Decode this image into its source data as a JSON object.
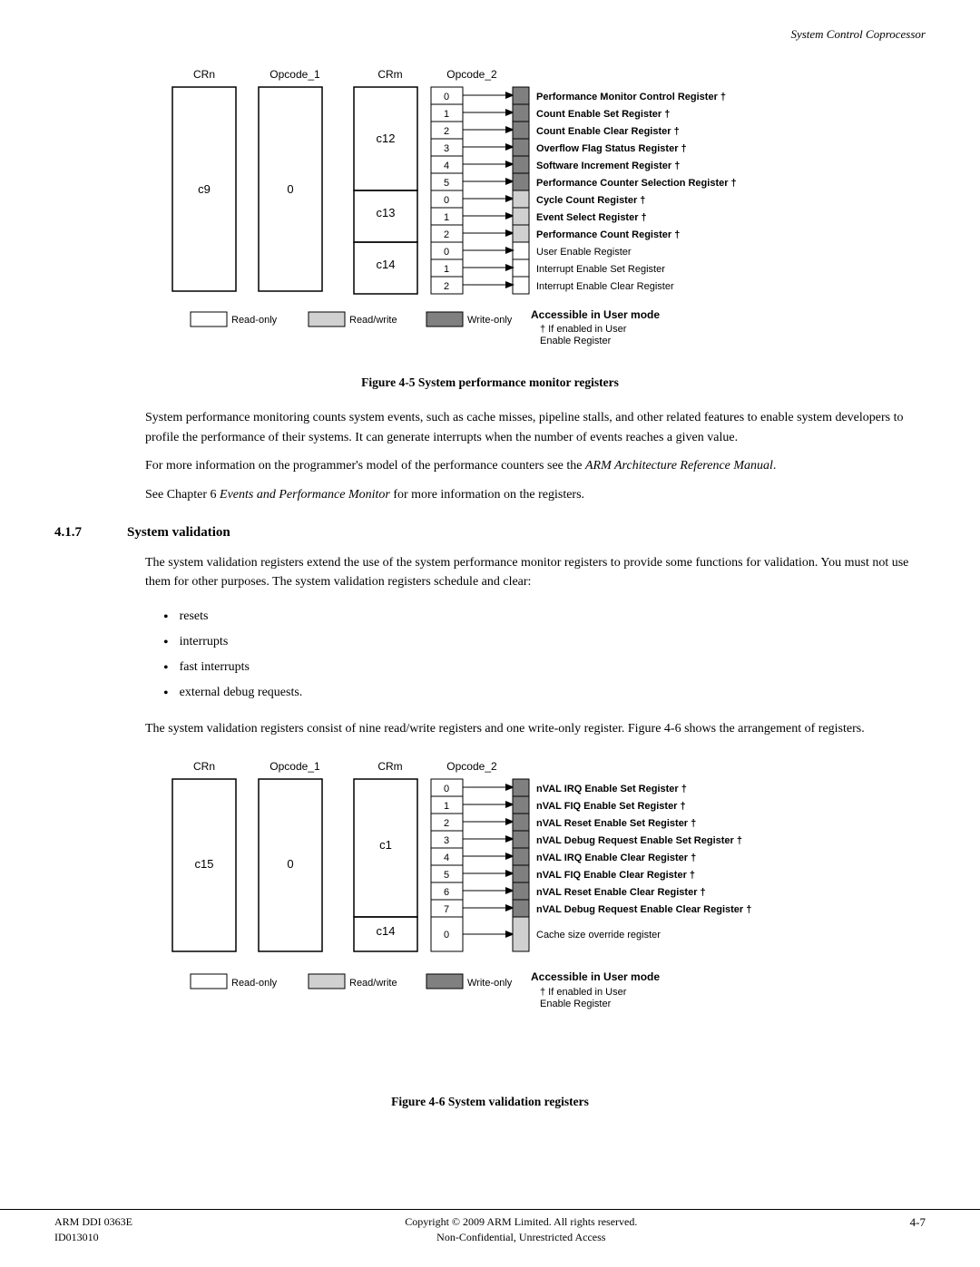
{
  "header": {
    "title": "System Control Coprocessor"
  },
  "figure5": {
    "caption": "Figure 4-5 System performance monitor registers",
    "diagram": {
      "headers": [
        "CRn",
        "Opcode_1",
        "CRm",
        "Opcode_2"
      ],
      "crn_val": "c9",
      "entries": [
        {
          "crm": "c12",
          "opcode": "0",
          "label": "Performance Monitor Control Register †",
          "bold": true,
          "type": "write"
        },
        {
          "crm": "",
          "opcode": "1",
          "label": "Count Enable Set Register †",
          "bold": true,
          "type": "write"
        },
        {
          "crm": "",
          "opcode": "2",
          "label": "Count Enable Clear Register †",
          "bold": true,
          "type": "write"
        },
        {
          "crm": "",
          "opcode": "3",
          "label": "Overflow Flag Status Register †",
          "bold": true,
          "type": "write"
        },
        {
          "crm": "",
          "opcode": "4",
          "label": "Software Increment Register †",
          "bold": true,
          "type": "write"
        },
        {
          "crm": "",
          "opcode": "5",
          "label": "Performance Counter Selection Register †",
          "bold": true,
          "type": "write"
        },
        {
          "crm": "c13",
          "opcode": "0",
          "label": "Cycle Count Register †",
          "bold": true,
          "type": "write"
        },
        {
          "crm": "",
          "opcode": "1",
          "label": "Event Select Register †",
          "bold": true,
          "type": "write"
        },
        {
          "crm": "",
          "opcode": "2",
          "label": "Performance Count Register †",
          "bold": true,
          "type": "write"
        },
        {
          "crm": "c14",
          "opcode": "0",
          "label": "User Enable Register",
          "bold": false,
          "type": "readwrite"
        },
        {
          "crm": "",
          "opcode": "1",
          "label": "Interrupt Enable Set Register",
          "bold": false,
          "type": "readwrite"
        },
        {
          "crm": "",
          "opcode": "2",
          "label": "Interrupt Enable Clear Register",
          "bold": false,
          "type": "readwrite"
        }
      ],
      "legend": {
        "readonly": "Read-only",
        "readwrite": "Read/write",
        "writeonly": "Write-only",
        "accessible": "Accessible in User mode",
        "note": "† If enabled in User Enable Register"
      }
    }
  },
  "text1": "System performance monitoring counts system events, such as cache misses, pipeline stalls, and other related features to enable system developers to profile the performance of their systems. It can generate interrupts when the number of events reaches a given value.",
  "text2": "For more information on the programmer's model of the performance counters see the",
  "text2_italic": "ARM Architecture Reference Manual",
  "text3": "See Chapter 6",
  "text3_italic": "Events and Performance Monitor",
  "text3_end": "for more information on the registers.",
  "section": {
    "number": "4.1.7",
    "title": "System validation"
  },
  "text4": "The system validation registers extend the use of the system performance monitor registers to provide some functions for validation. You must not use them for other purposes. The system validation registers schedule and clear:",
  "bullets": [
    "resets",
    "interrupts",
    "fast interrupts",
    "external debug requests."
  ],
  "text5": "The system validation registers consist of nine read/write registers and one write-only register. Figure 4-6 shows the arrangement of registers.",
  "figure6": {
    "caption": "Figure 4-6 System validation registers",
    "diagram": {
      "headers": [
        "CRn",
        "Opcode_1",
        "CRm",
        "Opcode_2"
      ],
      "crn_val": "c15",
      "entries": [
        {
          "crm": "c1",
          "opcode": "0",
          "label": "nVAL IRQ Enable Set Register †",
          "bold": true,
          "type": "write"
        },
        {
          "crm": "",
          "opcode": "1",
          "label": "nVAL FIQ Enable Set Register †",
          "bold": true,
          "type": "write"
        },
        {
          "crm": "",
          "opcode": "2",
          "label": "nVAL Reset Enable Set Register †",
          "bold": true,
          "type": "write"
        },
        {
          "crm": "",
          "opcode": "3",
          "label": "nVAL Debug Request Enable Set Register †",
          "bold": true,
          "type": "write"
        },
        {
          "crm": "",
          "opcode": "4",
          "label": "nVAL IRQ Enable Clear Register †",
          "bold": true,
          "type": "write"
        },
        {
          "crm": "",
          "opcode": "5",
          "label": "nVAL FIQ Enable Clear Register †",
          "bold": true,
          "type": "write"
        },
        {
          "crm": "",
          "opcode": "6",
          "label": "nVAL Reset Enable Clear Register †",
          "bold": true,
          "type": "write"
        },
        {
          "crm": "",
          "opcode": "7",
          "label": "nVAL Debug Request Enable Clear Register †",
          "bold": true,
          "type": "write"
        },
        {
          "crm": "c14",
          "opcode": "0",
          "label": "Cache size override register",
          "bold": false,
          "type": "readwrite"
        }
      ],
      "legend": {
        "readonly": "Read-only",
        "readwrite": "Read/write",
        "writeonly": "Write-only",
        "accessible": "Accessible in User mode",
        "note": "† If enabled in User Enable Register"
      }
    }
  },
  "footer": {
    "left1": "ARM DDI 0363E",
    "left2": "ID013010",
    "center1": "Copyright © 2009 ARM Limited. All rights reserved.",
    "center2": "Non-Confidential, Unrestricted Access",
    "right": "4-7"
  }
}
